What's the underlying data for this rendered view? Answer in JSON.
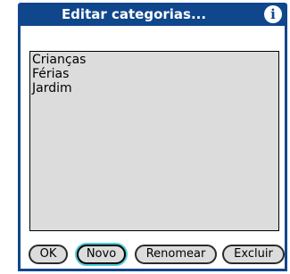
{
  "dialog": {
    "title": "Editar categorias...",
    "info_icon": "i"
  },
  "list": {
    "items": [
      {
        "label": "Crianças"
      },
      {
        "label": "Férias"
      },
      {
        "label": "Jardim"
      }
    ]
  },
  "buttons": {
    "ok": "OK",
    "new": "Novo",
    "rename": "Renomear",
    "delete": "Excluir"
  },
  "colors": {
    "title_bar": "#10478c",
    "list_background": "#dcdcdc",
    "focus_ring": "#4ecbd8"
  }
}
